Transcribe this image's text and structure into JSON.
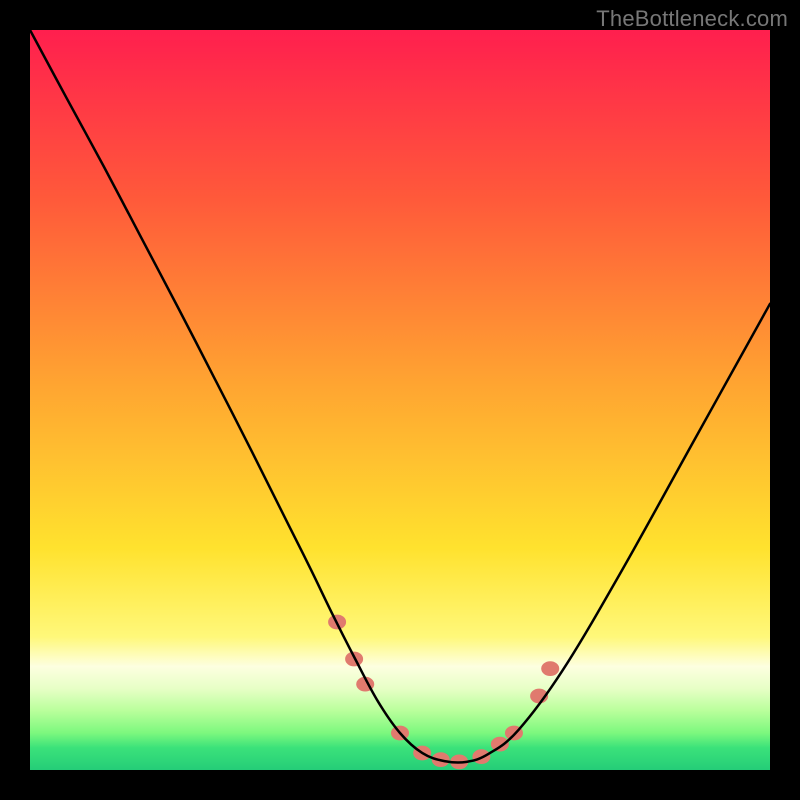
{
  "watermark": {
    "text": "TheBottleneck.com"
  },
  "chart_data": {
    "type": "line",
    "title": "",
    "xlabel": "",
    "ylabel": "",
    "xlim": [
      0,
      100
    ],
    "ylim": [
      0,
      100
    ],
    "gradient": {
      "stops": [
        {
          "offset": 0,
          "color": "#ff1f4e"
        },
        {
          "offset": 23,
          "color": "#ff5a3a"
        },
        {
          "offset": 48,
          "color": "#ffa531"
        },
        {
          "offset": 70,
          "color": "#ffe22e"
        },
        {
          "offset": 82,
          "color": "#fff87a"
        },
        {
          "offset": 86,
          "color": "#fdffe0"
        },
        {
          "offset": 89,
          "color": "#e7ffc6"
        },
        {
          "offset": 92,
          "color": "#b9ff9b"
        },
        {
          "offset": 95,
          "color": "#7cf87e"
        },
        {
          "offset": 97,
          "color": "#3be27a"
        },
        {
          "offset": 100,
          "color": "#25cd78"
        }
      ]
    },
    "series": [
      {
        "name": "curve",
        "x": [
          0,
          5,
          10,
          15,
          20,
          25,
          30,
          35,
          38,
          41,
          44,
          47,
          50,
          53,
          56,
          59,
          62,
          66,
          72,
          80,
          90,
          100
        ],
        "y": [
          100,
          90.7,
          81.5,
          72,
          62.5,
          52.8,
          43,
          33,
          27,
          20.8,
          14.9,
          9.3,
          5.0,
          2.3,
          1.2,
          1.1,
          2.2,
          5.4,
          13.5,
          27,
          45,
          63
        ],
        "stroke": "#000000",
        "width": 2.5
      }
    ],
    "markers": {
      "color": "#e07a6e",
      "radius_px": 9,
      "points": [
        {
          "x": 41.5,
          "y": 20.0
        },
        {
          "x": 43.8,
          "y": 15.0
        },
        {
          "x": 45.3,
          "y": 11.6
        },
        {
          "x": 50.0,
          "y": 5.0
        },
        {
          "x": 53.0,
          "y": 2.3
        },
        {
          "x": 55.5,
          "y": 1.4
        },
        {
          "x": 58.0,
          "y": 1.1
        },
        {
          "x": 61.0,
          "y": 1.8
        },
        {
          "x": 63.5,
          "y": 3.5
        },
        {
          "x": 65.4,
          "y": 5.0
        },
        {
          "x": 68.8,
          "y": 10.0
        },
        {
          "x": 70.3,
          "y": 13.7
        }
      ]
    }
  }
}
